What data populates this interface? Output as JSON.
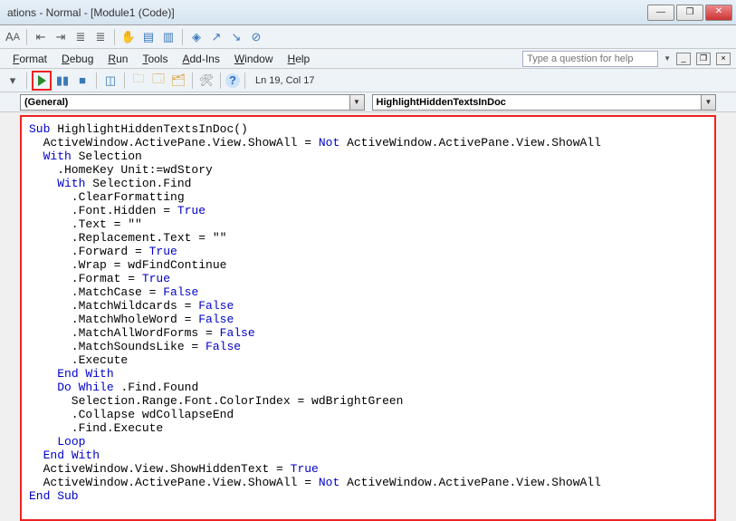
{
  "title": "ations - Normal - [Module1 (Code)]",
  "menus": [
    "Format",
    "Debug",
    "Run",
    "Tools",
    "Add-Ins",
    "Window",
    "Help"
  ],
  "help_placeholder": "Type a question for help",
  "statusbar": "Ln 19, Col 17",
  "combo_left": "(General)",
  "combo_right": "HighlightHiddenTextsInDoc",
  "code_tokens": [
    [
      "k",
      "Sub"
    ],
    [
      " HighlightHiddenTextsInDoc()",
      "\n"
    ],
    [
      "  ActiveWindow.ActivePane.View.ShowAll = "
    ],
    [
      "k",
      "Not"
    ],
    [
      " ActiveWindow.ActivePane.View.ShowAll",
      "\n"
    ],
    [
      "  "
    ],
    [
      "k",
      "With"
    ],
    [
      " Selection",
      "\n"
    ],
    [
      "    .HomeKey Unit:=wdStory",
      "\n"
    ],
    [
      "    "
    ],
    [
      "k",
      "With"
    ],
    [
      " Selection.Find",
      "\n"
    ],
    [
      "      .ClearFormatting",
      "\n"
    ],
    [
      "      .Font.Hidden = "
    ],
    [
      "k",
      "True"
    ],
    [
      "\n"
    ],
    [
      "      .Text = \"\"",
      "\n"
    ],
    [
      "      .Replacement.Text = \"\"",
      "\n"
    ],
    [
      "      .Forward = "
    ],
    [
      "k",
      "True"
    ],
    [
      "\n"
    ],
    [
      "      .Wrap = wdFindContinue",
      "\n"
    ],
    [
      "      .Format = "
    ],
    [
      "k",
      "True"
    ],
    [
      "\n"
    ],
    [
      "      .MatchCase = "
    ],
    [
      "k",
      "False"
    ],
    [
      "\n"
    ],
    [
      "      .MatchWildcards = "
    ],
    [
      "k",
      "False"
    ],
    [
      "\n"
    ],
    [
      "      .MatchWholeWord = "
    ],
    [
      "k",
      "False"
    ],
    [
      "\n"
    ],
    [
      "      .MatchAllWordForms = "
    ],
    [
      "k",
      "False"
    ],
    [
      "\n"
    ],
    [
      "      .MatchSoundsLike = "
    ],
    [
      "k",
      "False"
    ],
    [
      "\n"
    ],
    [
      "      .Execute",
      "\n"
    ],
    [
      "    "
    ],
    [
      "k",
      "End With"
    ],
    [
      "\n"
    ],
    [
      "    "
    ],
    [
      "k",
      "Do While"
    ],
    [
      " .Find.Found",
      "\n"
    ],
    [
      "      Selection.Range.Font.ColorIndex = wdBrightGreen",
      "\n"
    ],
    [
      "      .Collapse wdCollapseEnd",
      "\n"
    ],
    [
      "      .Find.Execute",
      "\n"
    ],
    [
      "    "
    ],
    [
      "k",
      "Loop"
    ],
    [
      "\n"
    ],
    [
      "  "
    ],
    [
      "k",
      "End With"
    ],
    [
      "\n"
    ],
    [
      "  ActiveWindow.View.ShowHiddenText = "
    ],
    [
      "k",
      "True"
    ],
    [
      "\n"
    ],
    [
      "  ActiveWindow.ActivePane.View.ShowAll = "
    ],
    [
      "k",
      "Not"
    ],
    [
      " ActiveWindow.ActivePane.View.ShowAll",
      "\n"
    ],
    [
      "k",
      "End Sub"
    ]
  ]
}
